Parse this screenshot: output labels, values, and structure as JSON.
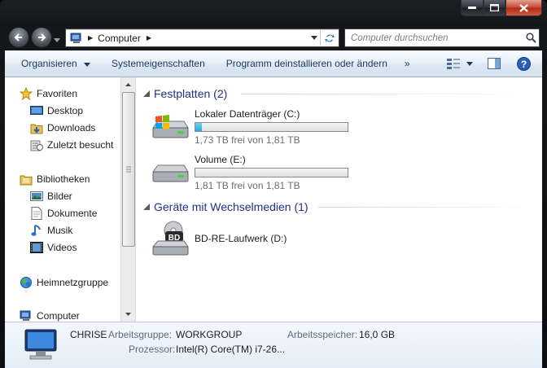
{
  "address": {
    "crumb": "Computer"
  },
  "search": {
    "placeholder": "Computer durchsuchen"
  },
  "toolbar": {
    "organize": "Organisieren",
    "properties": "Systemeigenschaften",
    "uninstall": "Programm deinstallieren oder ändern",
    "more": "»"
  },
  "sidebar": {
    "favorites": {
      "label": "Favoriten",
      "items": [
        "Desktop",
        "Downloads",
        "Zuletzt besucht"
      ]
    },
    "libraries": {
      "label": "Bibliotheken",
      "items": [
        "Bilder",
        "Dokumente",
        "Musik",
        "Videos"
      ]
    },
    "homegroup": "Heimnetzgruppe",
    "computer": "Computer"
  },
  "groups": {
    "harddisks": "Festplatten (2)",
    "removable": "Geräte mit Wechselmedien (1)"
  },
  "drives": [
    {
      "name": "Lokaler Datenträger (C:)",
      "free": "1,73 TB frei von 1,81 TB",
      "used_fraction": 0.044
    },
    {
      "name": "Volume (E:)",
      "free": "1,81 TB frei von 1,81 TB",
      "used_fraction": 0.0
    },
    {
      "name": "BD-RE-Laufwerk (D:)",
      "badge": "BD"
    }
  ],
  "details": {
    "name": "CHRISE",
    "workgroup_label": "Arbeitsgruppe:",
    "workgroup": "WORKGROUP",
    "memory_label": "Arbeitsspeicher:",
    "memory": "16,0 GB",
    "cpu_label": "Prozessor:",
    "cpu": "Intel(R) Core(TM) i7-26..."
  },
  "colors": {
    "accent": "#1e3287",
    "progress": "#27a7d8",
    "toolbar_text": "#1e395b"
  }
}
